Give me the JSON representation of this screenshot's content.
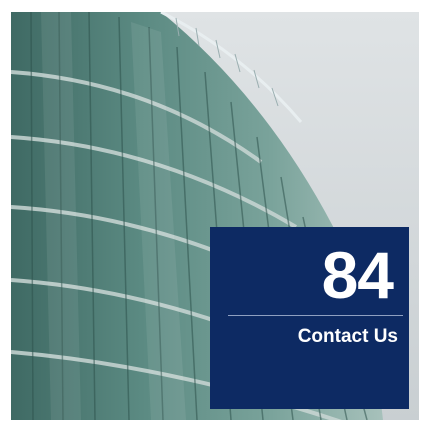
{
  "card": {
    "number": "84",
    "link_label": "Contact Us",
    "background_color": "#0d2a63"
  },
  "photo": {
    "subject": "glass-office-building"
  }
}
